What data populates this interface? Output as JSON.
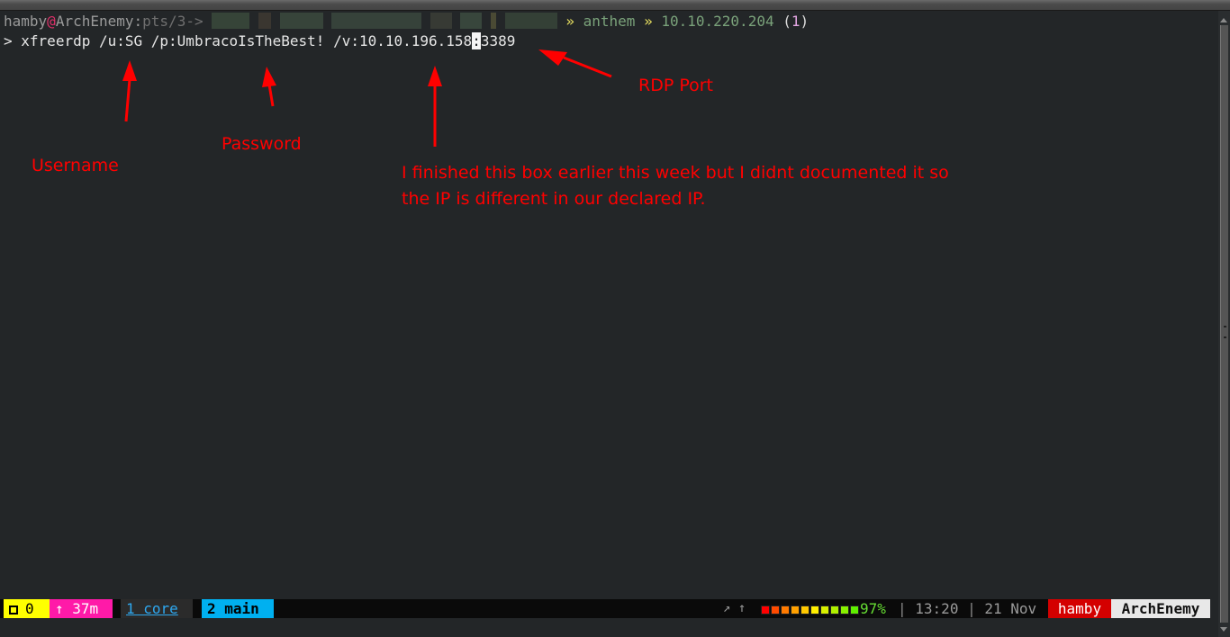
{
  "prompt": {
    "user": "hamby",
    "at": "@",
    "host": "ArchEnemy",
    "colon": ":",
    "tty": "pts/3->",
    "redacted_path_note": "pixelated",
    "sep1": "»",
    "dir": "anthem",
    "sep2": "»",
    "ip": "10.10.220.204",
    "paren_open": "(",
    "job_count": "1",
    "paren_close": ")"
  },
  "command": {
    "prompt_char": ">",
    "text_before_cursor": "xfreerdp /u:SG /p:UmbracoIsTheBest! /v:10.10.196.158",
    "cursor_char": ":",
    "text_after_cursor": "3389"
  },
  "annotations": {
    "username": "Username",
    "password": "Password",
    "rdp_port": "RDP Port",
    "note_line1": "I finished this box earlier this week but I didnt documented it so",
    "note_line2": "the IP is different in our declared IP.",
    "color": "#ff0000"
  },
  "statusbar": {
    "session_icon": "window-icon",
    "session_index": "0",
    "uptime": "↑ 37m",
    "window1": "1 core",
    "window2": "2 main",
    "net_indicators": "↗ ↑",
    "battery_percent": 97,
    "battery_label": "97%",
    "battery_colors": [
      "#ff0000",
      "#ff4a00",
      "#ff7a00",
      "#ffa000",
      "#ffc800",
      "#ffee00",
      "#d8f000",
      "#b0f000",
      "#88f000",
      "#60ee00"
    ],
    "sep": "|",
    "time": "13:20",
    "date": "21 Nov",
    "user": "hamby",
    "host": "ArchEnemy"
  }
}
